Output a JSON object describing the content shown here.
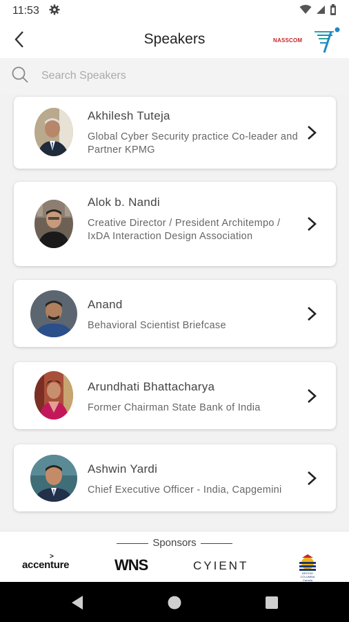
{
  "status_bar": {
    "time": "11:53",
    "icons": [
      "settings-gear-icon",
      "wifi-icon",
      "signal-icon",
      "battery-icon"
    ]
  },
  "app_bar": {
    "title": "Speakers",
    "back_icon": "chevron-left-icon",
    "brand_text": "NASSCOM"
  },
  "search": {
    "placeholder": "Search Speakers",
    "icon": "search-icon"
  },
  "speakers": [
    {
      "name": "Akhilesh Tuteja",
      "role": "Global Cyber Security practice Co-leader and Partner KPMG"
    },
    {
      "name": "Alok b. Nandi",
      "role": "Creative Director / President Architempo / IxDA Interaction Design Association"
    },
    {
      "name": "Anand",
      "role": "Behavioral Scientist Briefcase"
    },
    {
      "name": "Arundhati Bhattacharya",
      "role": "Former Chairman State Bank of India"
    },
    {
      "name": "Ashwin Yardi",
      "role": "Chief Executive Officer - India, Capgemini"
    }
  ],
  "sponsors": {
    "heading": "Sponsors",
    "logos": [
      "accenture",
      "WNS",
      "CYIENT"
    ]
  },
  "colors": {
    "brand_red": "#c62828",
    "brand_blue": "#1e88c8",
    "brand_teal": "#26a69a",
    "card_bg": "#ffffff",
    "page_bg": "#f2f2f2"
  },
  "nav_bar": {
    "icons": [
      "back-triangle-icon",
      "home-circle-icon",
      "recents-square-icon"
    ]
  }
}
